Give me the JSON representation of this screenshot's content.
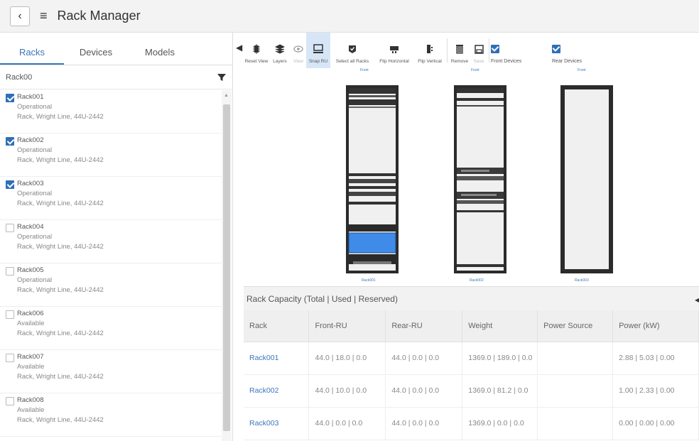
{
  "header": {
    "title": "Rack Manager"
  },
  "left": {
    "tabs": [
      {
        "label": "Racks",
        "active": true
      },
      {
        "label": "Devices",
        "active": false
      },
      {
        "label": "Models",
        "active": false
      }
    ],
    "search": {
      "value": "Rack00"
    },
    "racks": [
      {
        "name": "Rack001",
        "status": "Operational",
        "model": "Rack, Wright Line, 44U-2442",
        "checked": true
      },
      {
        "name": "Rack002",
        "status": "Operational",
        "model": "Rack, Wright Line, 44U-2442",
        "checked": true
      },
      {
        "name": "Rack003",
        "status": "Operational",
        "model": "Rack, Wright Line, 44U-2442",
        "checked": true
      },
      {
        "name": "Rack004",
        "status": "Operational",
        "model": "Rack, Wright Line, 44U-2442",
        "checked": false
      },
      {
        "name": "Rack005",
        "status": "Operational",
        "model": "Rack, Wright Line, 44U-2442",
        "checked": false
      },
      {
        "name": "Rack006",
        "status": "Available",
        "model": "Rack, Wright Line, 44U-2442",
        "checked": false
      },
      {
        "name": "Rack007",
        "status": "Available",
        "model": "Rack, Wright Line, 44U-2442",
        "checked": false
      },
      {
        "name": "Rack008",
        "status": "Available",
        "model": "Rack, Wright Line, 44U-2442",
        "checked": false
      }
    ]
  },
  "toolbar": {
    "reset_view": "Reset View",
    "layers": "Layers",
    "view": "View",
    "snap_ru": "Snap RU",
    "select_all_racks": "Select all Racks",
    "flip_horizontal": "Flip Horizontal",
    "flip_vertical": "Flip Vertical",
    "remove": "Remove",
    "save": "Save",
    "front_devices": "Front Devices",
    "rear_devices": "Rear Devices"
  },
  "viz": {
    "racks": [
      {
        "top_label": "Front",
        "bottom_label": "Rack001"
      },
      {
        "top_label": "Front",
        "bottom_label": "Rack002"
      },
      {
        "top_label": "Front",
        "bottom_label": "Rack003"
      }
    ]
  },
  "capacity": {
    "title": "Rack Capacity (Total | Used | Reserved)",
    "columns": [
      "Rack",
      "Front-RU",
      "Rear-RU",
      "Weight",
      "Power Source",
      "Power (kW)"
    ],
    "rows": [
      [
        "Rack001",
        "44.0 | 18.0 | 0.0",
        "44.0 | 0.0 | 0.0",
        "1369.0 | 189.0 | 0.0",
        "",
        "2.88 | 5.03 | 0.00"
      ],
      [
        "Rack002",
        "44.0 | 10.0 | 0.0",
        "44.0 | 0.0 | 0.0",
        "1369.0 | 81.2 | 0.0",
        "",
        "1.00 | 2.33 | 0.00"
      ],
      [
        "Rack003",
        "44.0 | 0.0 | 0.0",
        "44.0 | 0.0 | 0.0",
        "1369.0 | 0.0 | 0.0",
        "",
        "0.00 | 0.00 | 0.00"
      ]
    ]
  },
  "colors": {
    "accent": "#3a78b8",
    "checkbox": "#2f6fb7",
    "active_tool": "#d7e6f7"
  }
}
